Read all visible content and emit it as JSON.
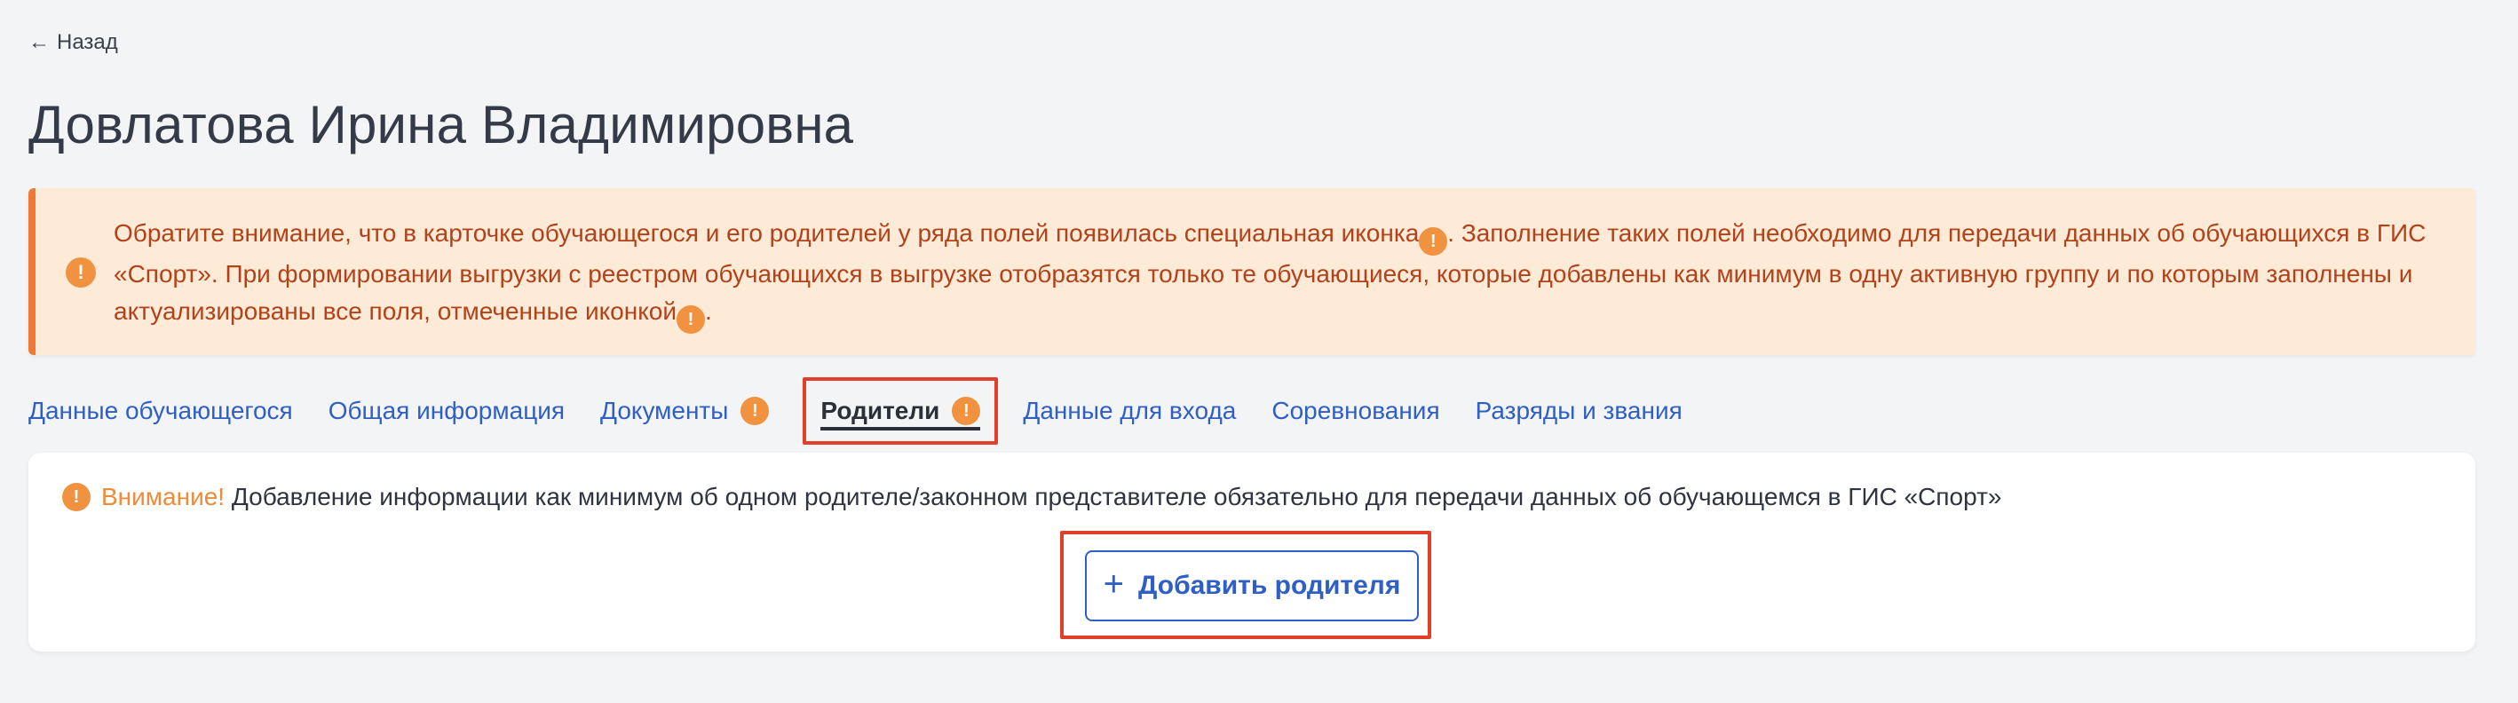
{
  "back": {
    "label": "Назад"
  },
  "title": "Довлатова Ирина Владимировна",
  "notice": {
    "part1": "Обратите внимание, что в карточке обучающегося и его родителей у ряда полей появилась специальная иконка",
    "part2": ". Заполнение таких полей необходимо для передачи данных об обучающихся в ГИС «Спорт». При формировании выгрузки с реестром обучающихся в выгрузке отобразятся только те обучающиеся, которые добавлены как минимум в одну активную группу и по которым заполнены и актуализированы все поля, отмеченные иконкой",
    "part3": "."
  },
  "tabs": [
    {
      "label": "Данные обучающегося"
    },
    {
      "label": "Общая информация"
    },
    {
      "label": "Документы"
    },
    {
      "label": "Родители"
    },
    {
      "label": "Данные для входа"
    },
    {
      "label": "Соревнования"
    },
    {
      "label": "Разряды и звания"
    }
  ],
  "card": {
    "attention": "Внимание!",
    "message": " Добавление информации как минимум об одном родителе/законном представителе обязательно для передачи данных об обучающемся в ГИС «Спорт»",
    "add_button": "Добавить родителя"
  },
  "icons": {
    "exclamation": "!",
    "plus": "+",
    "back_arrow": "←"
  },
  "colors": {
    "accent": "#2f5fc4",
    "warning_bg": "#fdebd8",
    "warning_text": "#b3421a",
    "warning_icon": "#f0923f",
    "highlight": "#e0402a"
  }
}
